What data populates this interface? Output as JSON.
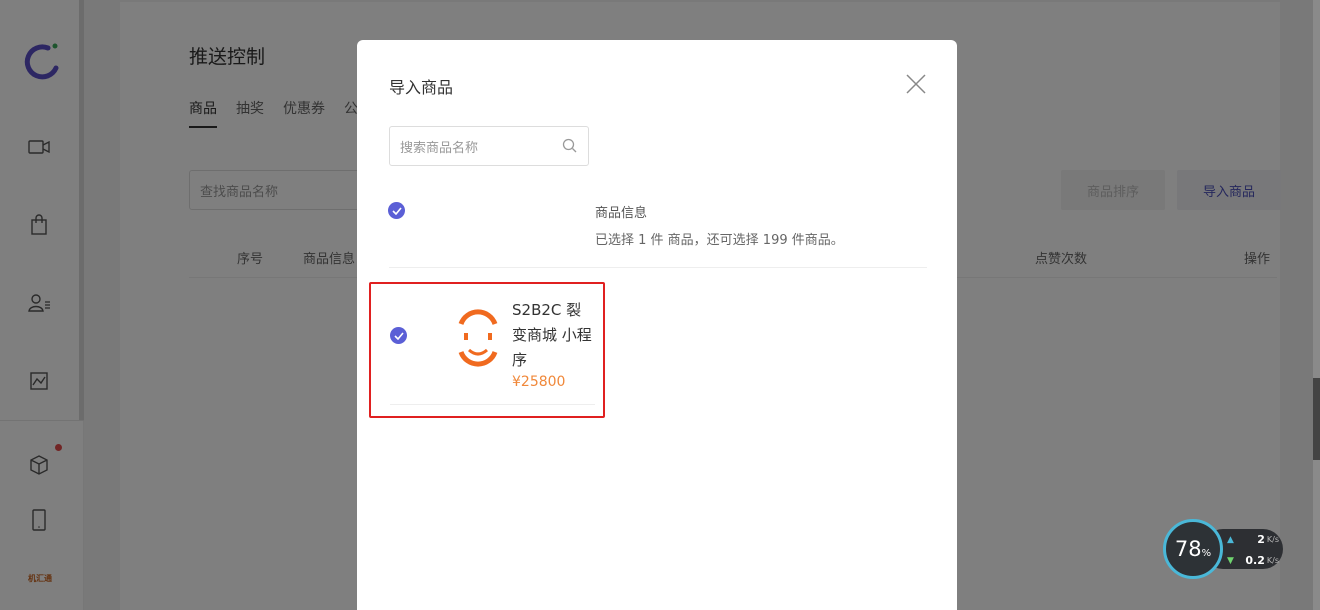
{
  "page": {
    "title": "推送控制",
    "tabs": [
      "商品",
      "抽奖",
      "优惠券",
      "公"
    ],
    "search_placeholder": "查找商品名称",
    "sort_button": "商品排序",
    "import_button": "导入商品",
    "table_headers": [
      "序号",
      "商品信息",
      "点赞次数",
      "操作"
    ]
  },
  "sidebar": {
    "icons": [
      "logo-icon",
      "video-icon",
      "shopping-bag-icon",
      "user-list-icon",
      "chart-icon",
      "box-icon",
      "mobile-icon"
    ],
    "brand_text": "机汇通"
  },
  "modal": {
    "title": "导入商品",
    "search_placeholder": "搜索商品名称",
    "info_label": "商品信息",
    "info_sub": "已选择 1 件 商品，还可选择 199 件商品。",
    "product": {
      "name": "S2B2C 裂变商城 小程序",
      "price": "¥25800",
      "selected": true
    }
  },
  "speed_widget": {
    "percent": "78",
    "percent_unit": "%",
    "up": "2",
    "down": "0.2",
    "unit": "K/s"
  },
  "colors": {
    "accent": "#5b5fd6",
    "price": "#f0883a",
    "highlight_border": "#e02020"
  }
}
